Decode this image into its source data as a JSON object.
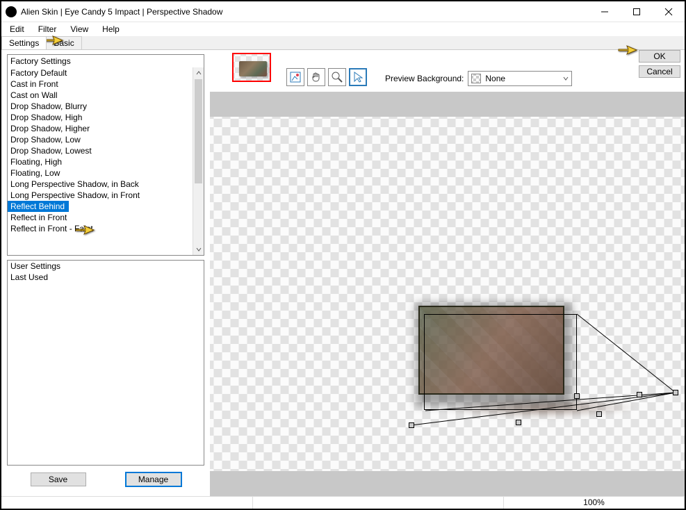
{
  "window": {
    "title": "Alien Skin | Eye Candy 5 Impact | Perspective Shadow"
  },
  "menus": {
    "edit": "Edit",
    "filter": "Filter",
    "view": "View",
    "help": "Help"
  },
  "tabs": {
    "settings": "Settings",
    "basic": "Basic"
  },
  "factory": {
    "header": "Factory Settings",
    "items": [
      "Factory Default",
      "Cast in Front",
      "Cast on Wall",
      "Drop Shadow, Blurry",
      "Drop Shadow, High",
      "Drop Shadow, Higher",
      "Drop Shadow, Low",
      "Drop Shadow, Lowest",
      "Floating, High",
      "Floating, Low",
      "Long Perspective Shadow, in Back",
      "Long Perspective Shadow, in Front",
      "Reflect Behind",
      "Reflect in Front",
      "Reflect in Front - Faint"
    ],
    "selected_index": 12
  },
  "user": {
    "header": "User Settings",
    "items": [
      "Last Used"
    ]
  },
  "buttons": {
    "save": "Save",
    "manage": "Manage",
    "ok": "OK",
    "cancel": "Cancel"
  },
  "preview": {
    "label": "Preview Background:",
    "selected": "None"
  },
  "status": {
    "zoom": "100%"
  },
  "tool_icons": {
    "nav": "navigator-icon",
    "hand": "hand-tool-icon",
    "zoom": "zoom-tool-icon",
    "pointer": "pointer-tool-icon"
  }
}
